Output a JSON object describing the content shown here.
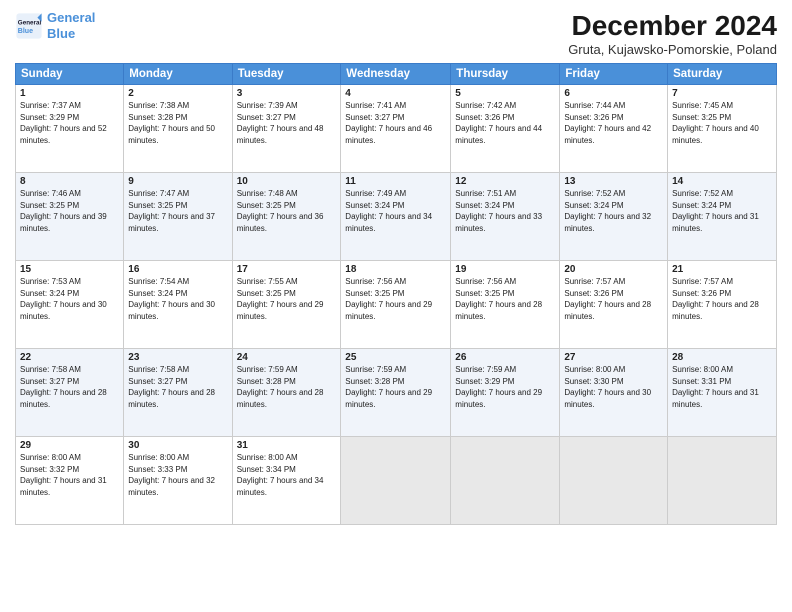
{
  "logo": {
    "line1": "General",
    "line2": "Blue"
  },
  "title": "December 2024",
  "subtitle": "Gruta, Kujawsko-Pomorskie, Poland",
  "header_days": [
    "Sunday",
    "Monday",
    "Tuesday",
    "Wednesday",
    "Thursday",
    "Friday",
    "Saturday"
  ],
  "weeks": [
    [
      {
        "day": "1",
        "sunrise": "Sunrise: 7:37 AM",
        "sunset": "Sunset: 3:29 PM",
        "daylight": "Daylight: 7 hours and 52 minutes."
      },
      {
        "day": "2",
        "sunrise": "Sunrise: 7:38 AM",
        "sunset": "Sunset: 3:28 PM",
        "daylight": "Daylight: 7 hours and 50 minutes."
      },
      {
        "day": "3",
        "sunrise": "Sunrise: 7:39 AM",
        "sunset": "Sunset: 3:27 PM",
        "daylight": "Daylight: 7 hours and 48 minutes."
      },
      {
        "day": "4",
        "sunrise": "Sunrise: 7:41 AM",
        "sunset": "Sunset: 3:27 PM",
        "daylight": "Daylight: 7 hours and 46 minutes."
      },
      {
        "day": "5",
        "sunrise": "Sunrise: 7:42 AM",
        "sunset": "Sunset: 3:26 PM",
        "daylight": "Daylight: 7 hours and 44 minutes."
      },
      {
        "day": "6",
        "sunrise": "Sunrise: 7:44 AM",
        "sunset": "Sunset: 3:26 PM",
        "daylight": "Daylight: 7 hours and 42 minutes."
      },
      {
        "day": "7",
        "sunrise": "Sunrise: 7:45 AM",
        "sunset": "Sunset: 3:25 PM",
        "daylight": "Daylight: 7 hours and 40 minutes."
      }
    ],
    [
      {
        "day": "8",
        "sunrise": "Sunrise: 7:46 AM",
        "sunset": "Sunset: 3:25 PM",
        "daylight": "Daylight: 7 hours and 39 minutes."
      },
      {
        "day": "9",
        "sunrise": "Sunrise: 7:47 AM",
        "sunset": "Sunset: 3:25 PM",
        "daylight": "Daylight: 7 hours and 37 minutes."
      },
      {
        "day": "10",
        "sunrise": "Sunrise: 7:48 AM",
        "sunset": "Sunset: 3:25 PM",
        "daylight": "Daylight: 7 hours and 36 minutes."
      },
      {
        "day": "11",
        "sunrise": "Sunrise: 7:49 AM",
        "sunset": "Sunset: 3:24 PM",
        "daylight": "Daylight: 7 hours and 34 minutes."
      },
      {
        "day": "12",
        "sunrise": "Sunrise: 7:51 AM",
        "sunset": "Sunset: 3:24 PM",
        "daylight": "Daylight: 7 hours and 33 minutes."
      },
      {
        "day": "13",
        "sunrise": "Sunrise: 7:52 AM",
        "sunset": "Sunset: 3:24 PM",
        "daylight": "Daylight: 7 hours and 32 minutes."
      },
      {
        "day": "14",
        "sunrise": "Sunrise: 7:52 AM",
        "sunset": "Sunset: 3:24 PM",
        "daylight": "Daylight: 7 hours and 31 minutes."
      }
    ],
    [
      {
        "day": "15",
        "sunrise": "Sunrise: 7:53 AM",
        "sunset": "Sunset: 3:24 PM",
        "daylight": "Daylight: 7 hours and 30 minutes."
      },
      {
        "day": "16",
        "sunrise": "Sunrise: 7:54 AM",
        "sunset": "Sunset: 3:24 PM",
        "daylight": "Daylight: 7 hours and 30 minutes."
      },
      {
        "day": "17",
        "sunrise": "Sunrise: 7:55 AM",
        "sunset": "Sunset: 3:25 PM",
        "daylight": "Daylight: 7 hours and 29 minutes."
      },
      {
        "day": "18",
        "sunrise": "Sunrise: 7:56 AM",
        "sunset": "Sunset: 3:25 PM",
        "daylight": "Daylight: 7 hours and 29 minutes."
      },
      {
        "day": "19",
        "sunrise": "Sunrise: 7:56 AM",
        "sunset": "Sunset: 3:25 PM",
        "daylight": "Daylight: 7 hours and 28 minutes."
      },
      {
        "day": "20",
        "sunrise": "Sunrise: 7:57 AM",
        "sunset": "Sunset: 3:26 PM",
        "daylight": "Daylight: 7 hours and 28 minutes."
      },
      {
        "day": "21",
        "sunrise": "Sunrise: 7:57 AM",
        "sunset": "Sunset: 3:26 PM",
        "daylight": "Daylight: 7 hours and 28 minutes."
      }
    ],
    [
      {
        "day": "22",
        "sunrise": "Sunrise: 7:58 AM",
        "sunset": "Sunset: 3:27 PM",
        "daylight": "Daylight: 7 hours and 28 minutes."
      },
      {
        "day": "23",
        "sunrise": "Sunrise: 7:58 AM",
        "sunset": "Sunset: 3:27 PM",
        "daylight": "Daylight: 7 hours and 28 minutes."
      },
      {
        "day": "24",
        "sunrise": "Sunrise: 7:59 AM",
        "sunset": "Sunset: 3:28 PM",
        "daylight": "Daylight: 7 hours and 28 minutes."
      },
      {
        "day": "25",
        "sunrise": "Sunrise: 7:59 AM",
        "sunset": "Sunset: 3:28 PM",
        "daylight": "Daylight: 7 hours and 29 minutes."
      },
      {
        "day": "26",
        "sunrise": "Sunrise: 7:59 AM",
        "sunset": "Sunset: 3:29 PM",
        "daylight": "Daylight: 7 hours and 29 minutes."
      },
      {
        "day": "27",
        "sunrise": "Sunrise: 8:00 AM",
        "sunset": "Sunset: 3:30 PM",
        "daylight": "Daylight: 7 hours and 30 minutes."
      },
      {
        "day": "28",
        "sunrise": "Sunrise: 8:00 AM",
        "sunset": "Sunset: 3:31 PM",
        "daylight": "Daylight: 7 hours and 31 minutes."
      }
    ],
    [
      {
        "day": "29",
        "sunrise": "Sunrise: 8:00 AM",
        "sunset": "Sunset: 3:32 PM",
        "daylight": "Daylight: 7 hours and 31 minutes."
      },
      {
        "day": "30",
        "sunrise": "Sunrise: 8:00 AM",
        "sunset": "Sunset: 3:33 PM",
        "daylight": "Daylight: 7 hours and 32 minutes."
      },
      {
        "day": "31",
        "sunrise": "Sunrise: 8:00 AM",
        "sunset": "Sunset: 3:34 PM",
        "daylight": "Daylight: 7 hours and 34 minutes."
      },
      null,
      null,
      null,
      null
    ]
  ]
}
